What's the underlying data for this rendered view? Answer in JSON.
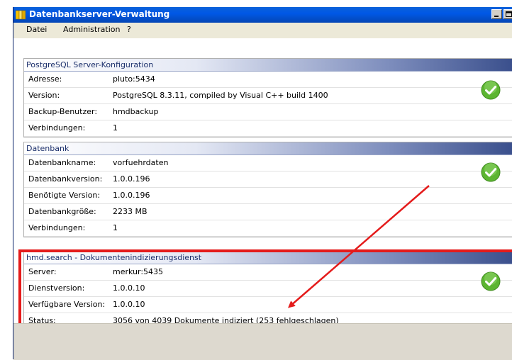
{
  "window": {
    "title": "Datenbankserver-Verwaltung"
  },
  "menu": [
    "Datei",
    "Administration",
    "?"
  ],
  "panels": [
    {
      "header": "PostgreSQL Server-Konfiguration",
      "rows": [
        {
          "label": "Adresse:",
          "value": "pluto:5434"
        },
        {
          "label": "Version:",
          "value": "PostgreSQL 8.3.11, compiled by Visual C++ build 1400"
        },
        {
          "label": "Backup-Benutzer:",
          "value": "hmdbackup"
        },
        {
          "label": "Verbindungen:",
          "value": "1"
        }
      ],
      "status_icon": "green-check-icon"
    },
    {
      "header": "Datenbank",
      "rows": [
        {
          "label": "Datenbankname:",
          "value": "vorfuehrdaten"
        },
        {
          "label": "Datenbankversion:",
          "value": "1.0.0.196"
        },
        {
          "label": "Benötigte Version:",
          "value": "1.0.0.196"
        },
        {
          "label": "Datenbankgröße:",
          "value": "2233 MB"
        },
        {
          "label": "Verbindungen:",
          "value": "1"
        }
      ],
      "status_icon": "green-check-icon"
    },
    {
      "header": "hmd.search - Dokumentenindizierungsdienst",
      "rows": [
        {
          "label": "Server:",
          "value": "merkur:5435"
        },
        {
          "label": "Dienstversion:",
          "value": "1.0.0.10"
        },
        {
          "label": "Verfügbare Version:",
          "value": "1.0.0.10"
        },
        {
          "label": "Status:",
          "value": "3056 von 4039 Dokumente indiziert (253 fehlgeschlagen)"
        }
      ],
      "status_icon": "green-check-icon"
    }
  ],
  "colors": {
    "titlebar": "#0058e6",
    "highlight": "#e41b1b",
    "check": "#5cb531"
  }
}
